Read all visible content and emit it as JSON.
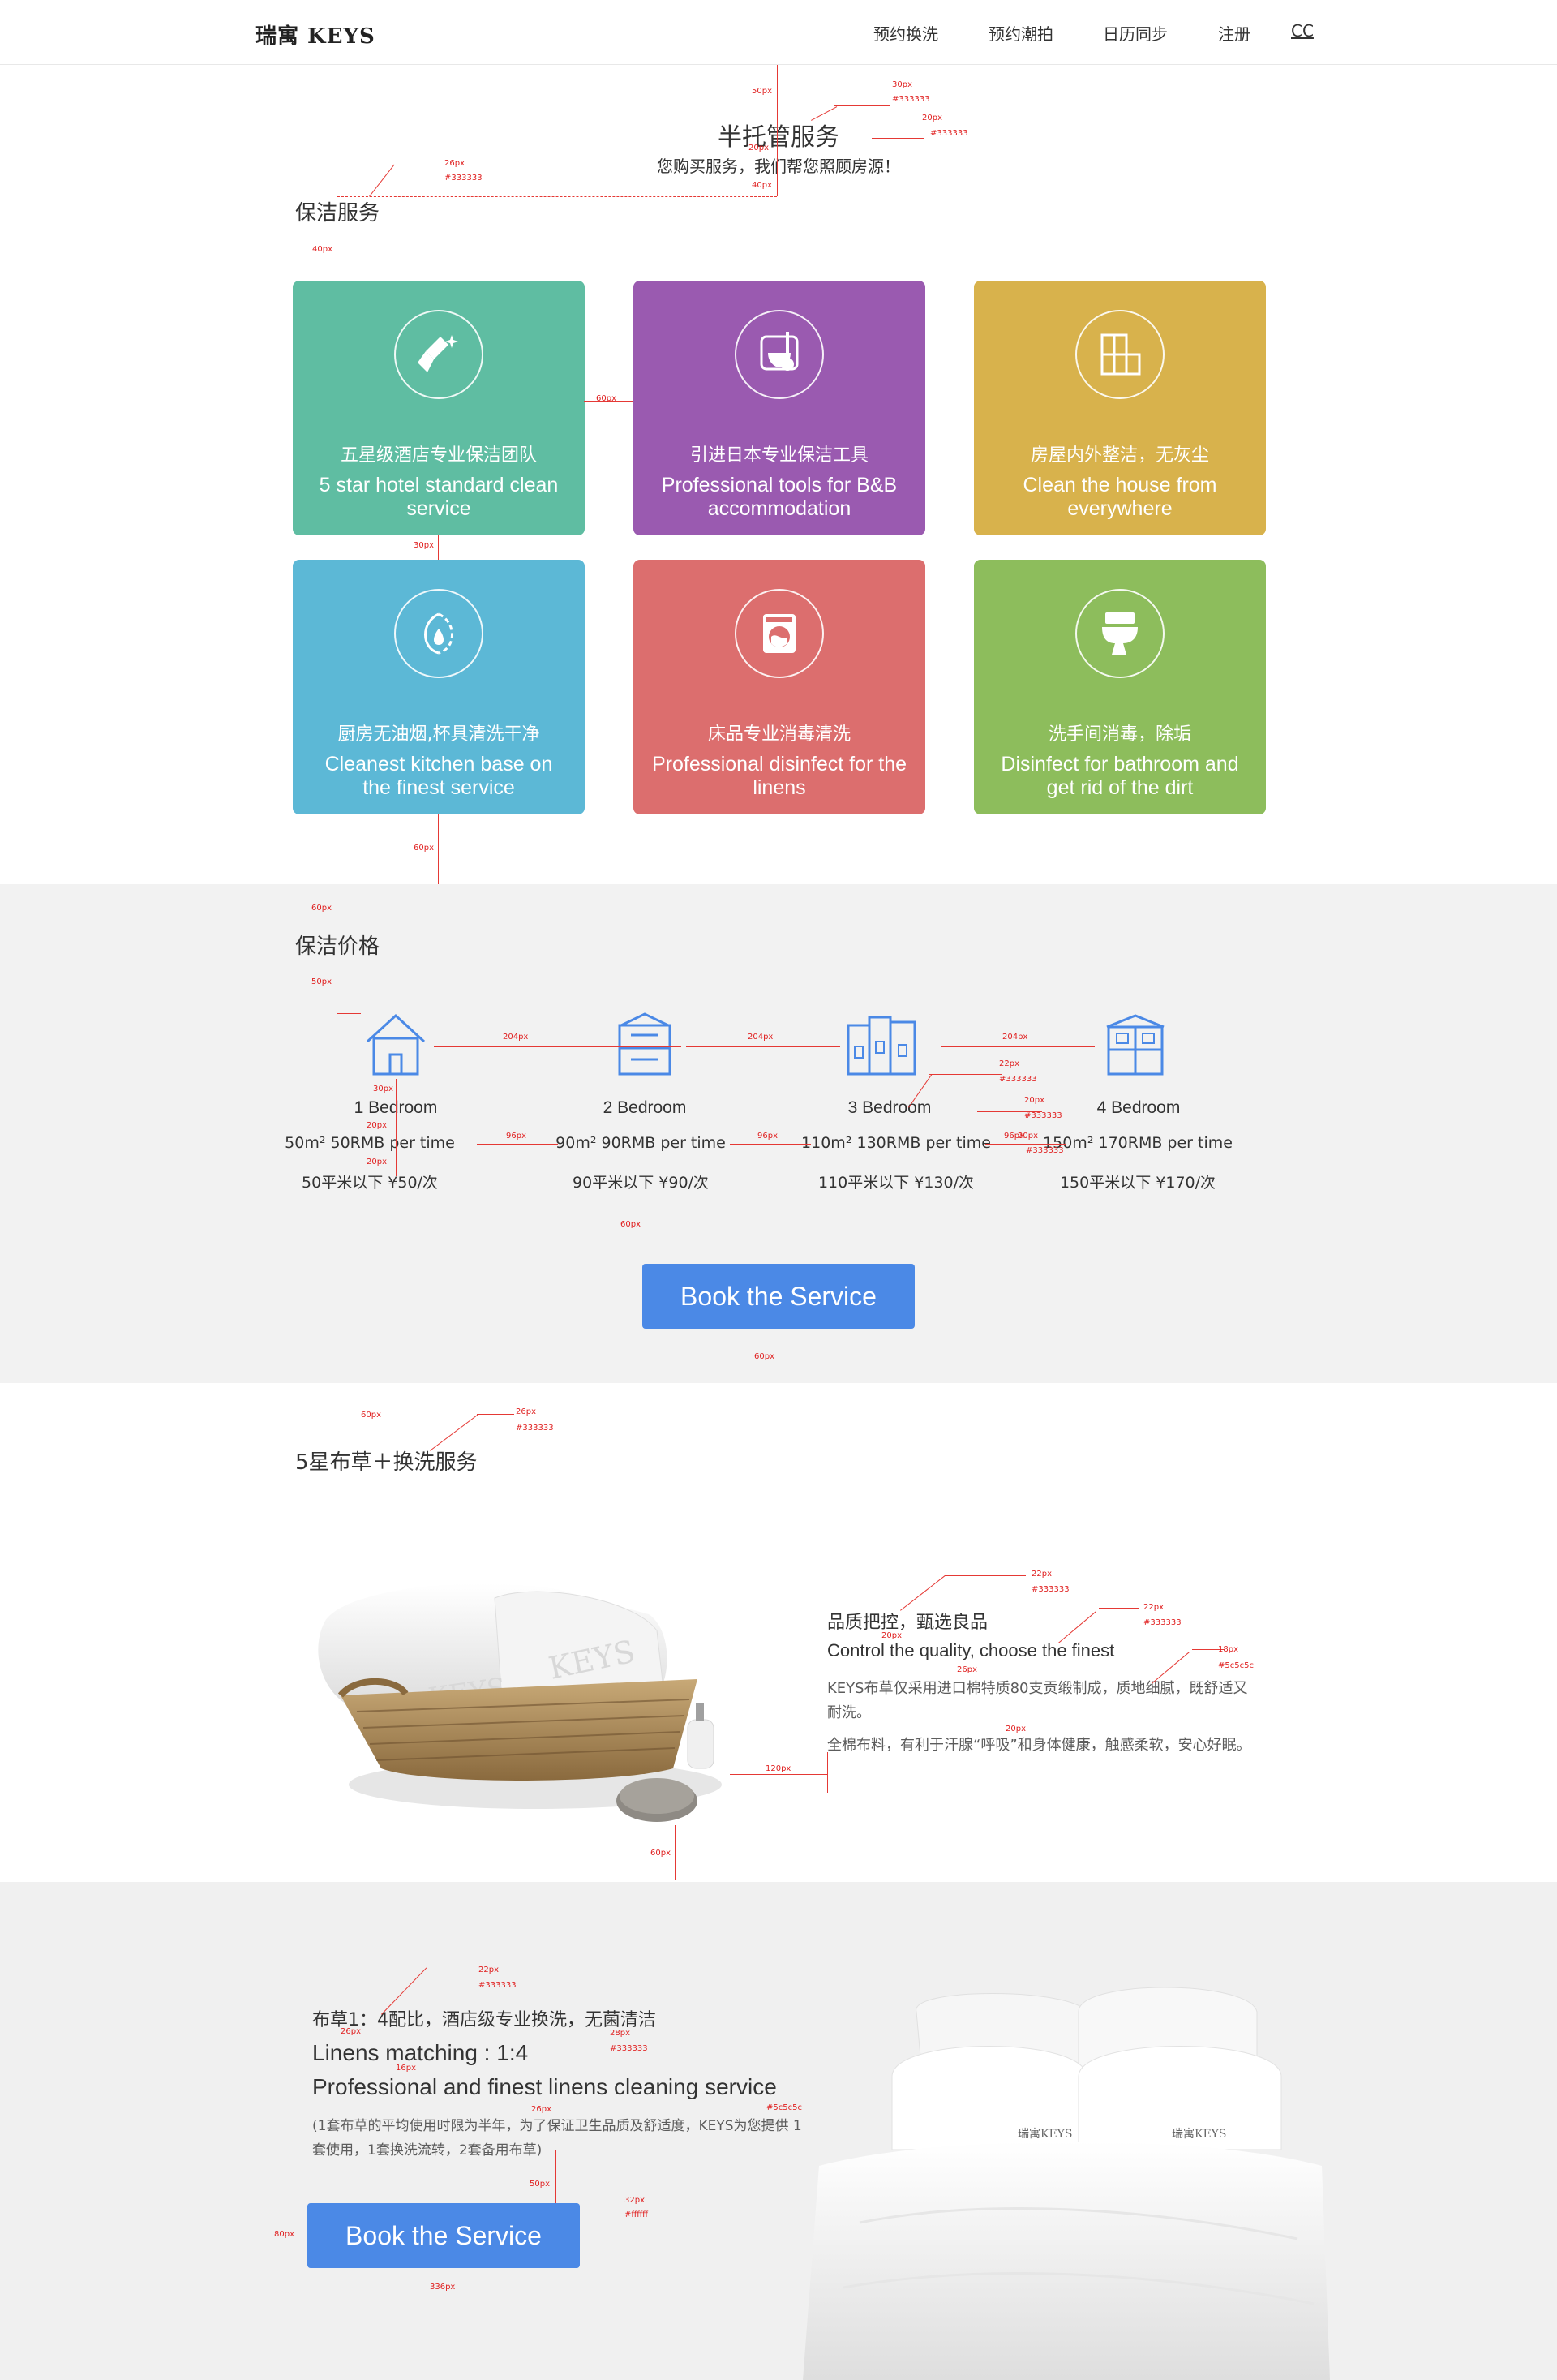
{
  "header": {
    "logo": "瑞寓 KEYS",
    "nav": [
      "预约换洗",
      "预约潮拍",
      "日历同步",
      "注册",
      "CC"
    ]
  },
  "hero": {
    "title": "半托管服务",
    "subtitle": "您购买服务，我们帮您照顾房源！"
  },
  "cleaning": {
    "title": "保洁服务",
    "cards": [
      {
        "cn": "五星级酒店专业保洁团队",
        "en": "5 star hotel standard clean service",
        "color": "#5fbda2",
        "icon": "broom-sparkle-icon"
      },
      {
        "cn": "引进日本专业保洁工具",
        "en": "Professional tools for B&B accommodation",
        "color": "#9a5ab0",
        "icon": "mop-bucket-icon"
      },
      {
        "cn": "房屋内外整洁，无灰尘",
        "en": "Clean the house from everywhere",
        "color": "#d8b24c",
        "icon": "cabinet-icon"
      },
      {
        "cn": "厨房无油烟,杯具清洗干净",
        "en": "Cleanest kitchen base on the finest service",
        "color": "#5cb8d6",
        "icon": "water-drop-icon"
      },
      {
        "cn": "床品专业消毒清洗",
        "en": "Professional disinfect for the linens",
        "color": "#dc6e6e",
        "icon": "washing-machine-icon"
      },
      {
        "cn": "洗手间消毒，除垢",
        "en": "Disinfect for bathroom and get rid of the dirt",
        "color": "#8dbd5c",
        "icon": "toilet-icon"
      }
    ]
  },
  "pricing": {
    "title": "保洁价格",
    "rooms": [
      {
        "name": "1 Bedroom",
        "line1": "50m² 50RMB per time",
        "line2": "50平米以下  ¥50/次",
        "icon": "house-1-icon"
      },
      {
        "name": "2 Bedroom",
        "line1": "90m² 90RMB per time",
        "line2": "90平米以下  ¥90/次",
        "icon": "house-2-icon"
      },
      {
        "name": "3 Bedroom",
        "line1": "110m² 130RMB per time",
        "line2": "110平米以下  ¥130/次",
        "icon": "house-3-icon"
      },
      {
        "name": "4 Bedroom",
        "line1": "150m² 170RMB per time",
        "line2": "150平米以下  ¥170/次",
        "icon": "house-4-icon"
      }
    ],
    "book_label": "Book the Service"
  },
  "linen": {
    "title": "5星布草＋换洗服务",
    "quality_cn": "品质把控，甄选良品",
    "quality_en": "Control the quality, choose the finest",
    "desc1": "KEYS布草仅采用进口棉特质80支贡缎制成，质地细腻，既舒适又耐洗。",
    "desc2": "全棉布料，有利于汗腺“呼吸”和身体健康，触感柔软，安心好眠。",
    "towel_brand": "KEYS"
  },
  "linen2": {
    "title_cn": "布草1：4配比，酒店级专业换洗，无菌清洁",
    "title_en1": "Linens matching : 1:4",
    "title_en2": "Professional and finest linens cleaning service",
    "note": "(1套布草的平均使用时限为半年，为了保证卫生品质及舒适度，KEYS为您提供 1套使用，1套换洗流转，2套备用布草)",
    "book_label": "Book the Service",
    "pillow_brand": "瑞寓KEYS"
  },
  "annotations": {
    "a1": "50px",
    "a2": "30px",
    "a3": "#333333",
    "a4": "20px",
    "a5": "#333333",
    "a6": "20px",
    "a7": "40px",
    "a8": "26px",
    "a9": "#333333",
    "a10": "40px",
    "a11": "60px",
    "a12": "30px",
    "a13": "60px",
    "a14": "60px",
    "a15": "50px",
    "a16": "204px",
    "a17": "204px",
    "a18": "204px",
    "a19": "30px",
    "a20": "20px",
    "a21": "20px",
    "a22": "96px",
    "a23": "96px",
    "a24": "96px",
    "a25": "22px",
    "a26": "#333333",
    "a27": "20px",
    "a28": "#333333",
    "a29": "20px",
    "a30": "#333333",
    "a31": "60px",
    "a32": "60px",
    "a33": "60px",
    "a34": "26px",
    "a35": "#333333",
    "a36": "22px",
    "a37": "#333333",
    "a38": "22px",
    "a39": "#333333",
    "a40": "20px",
    "a41": "26px",
    "a42": "18px",
    "a43": "#5c5c5c",
    "a44": "20px",
    "a45": "120px",
    "a46": "60px",
    "a47": "22px",
    "a48": "#333333",
    "a49": "26px",
    "a50": "28px",
    "a51": "#333333",
    "a52": "16px",
    "a53": "26px",
    "a54": "#5c5c5c",
    "a55": "50px",
    "a56": "32px",
    "a57": "#ffffff",
    "a58": "80px",
    "a59": "336px"
  }
}
